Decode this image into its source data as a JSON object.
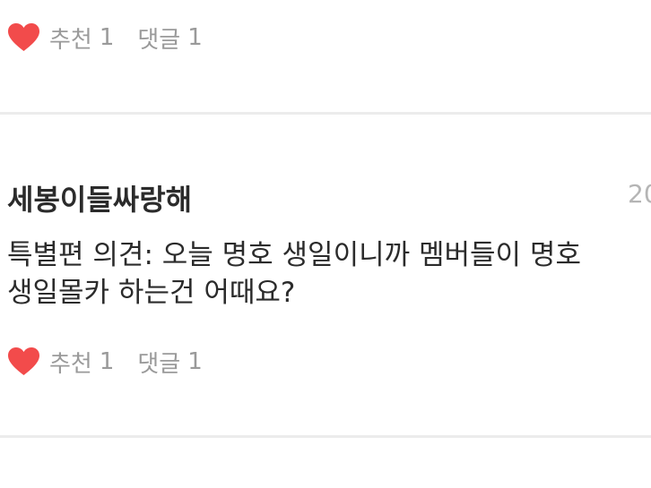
{
  "colors": {
    "heart": "#f24b4b",
    "meta_text": "#9a9a9a",
    "body_text": "#2b2b2b",
    "divider": "#ececec"
  },
  "icons": {
    "like": "heart-icon"
  },
  "previous_post": {
    "like_label": "추천",
    "like_count": "1",
    "comment_label": "댓글",
    "comment_count": "1"
  },
  "post": {
    "author": "세봉이들싸랑해",
    "date": "20",
    "body_line1": "특별편 의견: 오늘 명호 생일이니까 멤버들이 명호",
    "body_line2": "생일몰카 하는건 어때요?",
    "like_label": "추천",
    "like_count": "1",
    "comment_label": "댓글",
    "comment_count": "1"
  }
}
